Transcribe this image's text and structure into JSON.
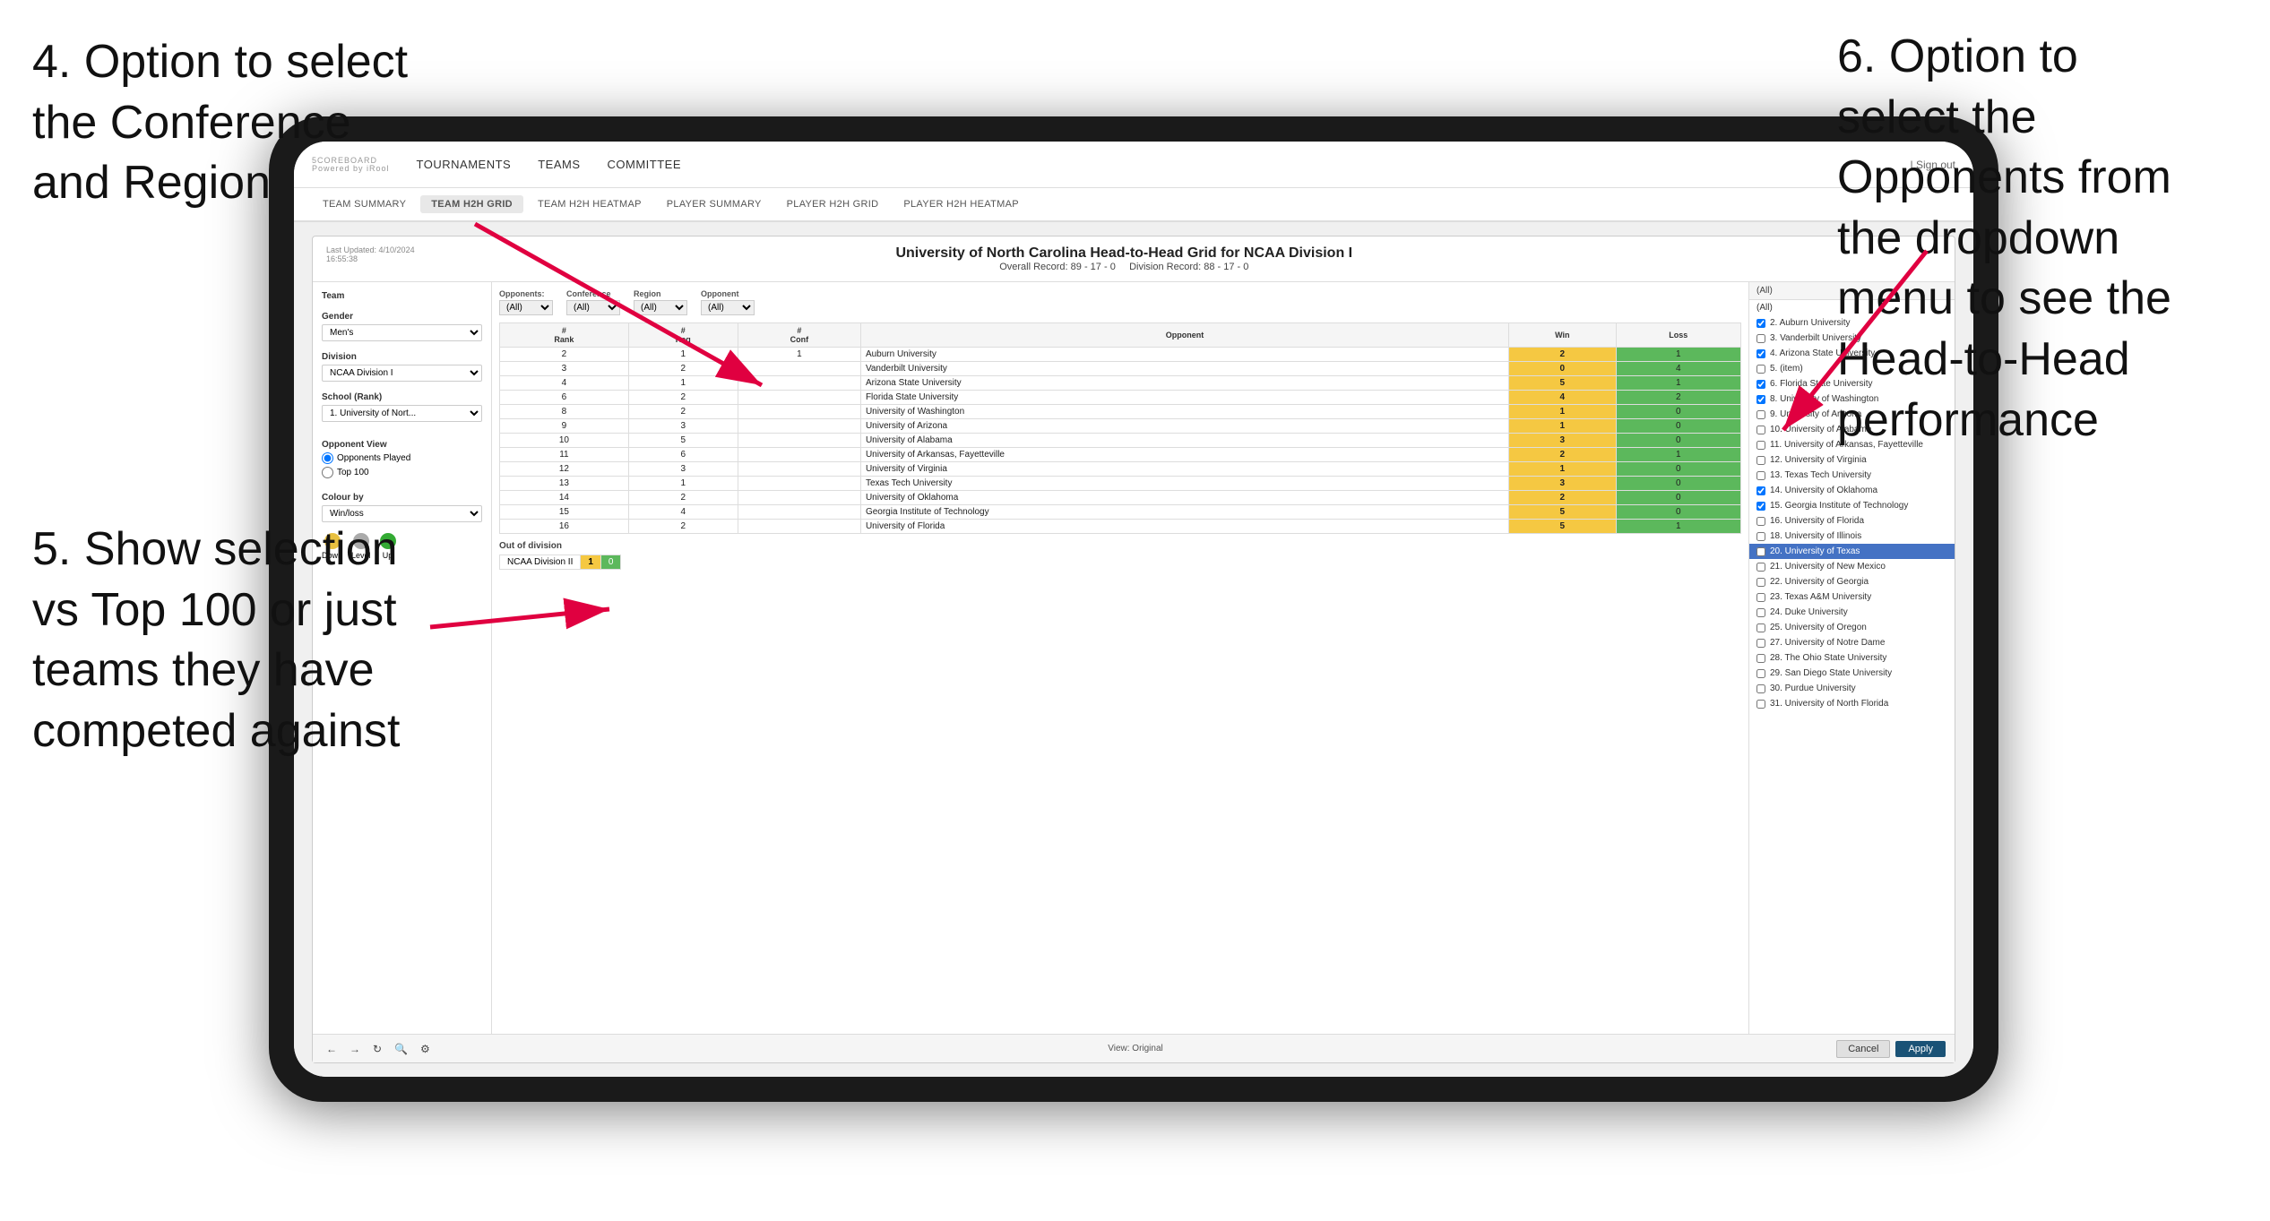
{
  "annotations": {
    "top_left": "4. Option to select\nthe Conference\nand Region",
    "bottom_left": "5. Show selection\nvs Top 100 or just\nteams they have\ncompeted against",
    "top_right": "6. Option to\nselect the\nOpponents from\nthe dropdown\nmenu to see the\nHead-to-Head\nperformance"
  },
  "app": {
    "logo": "5COREBOARD",
    "logo_sub": "Powered by iRool",
    "nav_links": [
      "TOURNAMENTS",
      "TEAMS",
      "COMMITTEE"
    ],
    "nav_right": "| Sign out",
    "sub_nav": [
      "TEAM SUMMARY",
      "TEAM H2H GRID",
      "TEAM H2H HEATMAP",
      "PLAYER SUMMARY",
      "PLAYER H2H GRID",
      "PLAYER H2H HEATMAP"
    ]
  },
  "panel": {
    "last_updated_label": "Last Updated: 4/10/2024",
    "last_updated_time": "16:55:38",
    "title": "University of North Carolina Head-to-Head Grid for NCAA Division I",
    "overall_record_label": "Overall Record:",
    "overall_record": "89 - 17 - 0",
    "division_record_label": "Division Record:",
    "division_record": "88 - 17 - 0"
  },
  "sidebar": {
    "team_label": "Team",
    "gender_label": "Gender",
    "gender_value": "Men's",
    "division_label": "Division",
    "division_value": "NCAA Division I",
    "school_label": "School (Rank)",
    "school_value": "1. University of Nort...",
    "opponent_view_label": "Opponent View",
    "opponents_played": "Opponents Played",
    "top_100": "Top 100",
    "colour_by_label": "Colour by",
    "colour_value": "Win/loss",
    "legend": {
      "down_label": "Down",
      "level_label": "Level",
      "up_label": "Up"
    }
  },
  "filters": {
    "opponents_label": "Opponents:",
    "opponents_value": "(All)",
    "conference_label": "Conference",
    "conference_value": "(All)",
    "region_label": "Region",
    "region_value": "(All)",
    "opponent_label": "Opponent",
    "opponent_value": "(All)"
  },
  "table": {
    "headers": [
      "#\nRank",
      "#\nReg",
      "#\nConf",
      "Opponent",
      "Win",
      "Loss"
    ],
    "rows": [
      {
        "rank": "2",
        "reg": "1",
        "conf": "1",
        "opponent": "Auburn University",
        "win": "2",
        "loss": "1",
        "win_color": "yellow",
        "loss_color": "green"
      },
      {
        "rank": "3",
        "reg": "2",
        "conf": "",
        "opponent": "Vanderbilt University",
        "win": "0",
        "loss": "4",
        "win_color": "yellow",
        "loss_color": "green"
      },
      {
        "rank": "4",
        "reg": "1",
        "conf": "",
        "opponent": "Arizona State University",
        "win": "5",
        "loss": "1",
        "win_color": "yellow",
        "loss_color": "green"
      },
      {
        "rank": "6",
        "reg": "2",
        "conf": "",
        "opponent": "Florida State University",
        "win": "4",
        "loss": "2",
        "win_color": "yellow",
        "loss_color": "green"
      },
      {
        "rank": "8",
        "reg": "2",
        "conf": "",
        "opponent": "University of Washington",
        "win": "1",
        "loss": "0",
        "win_color": "yellow",
        "loss_color": "green"
      },
      {
        "rank": "9",
        "reg": "3",
        "conf": "",
        "opponent": "University of Arizona",
        "win": "1",
        "loss": "0",
        "win_color": "yellow",
        "loss_color": "green"
      },
      {
        "rank": "10",
        "reg": "5",
        "conf": "",
        "opponent": "University of Alabama",
        "win": "3",
        "loss": "0",
        "win_color": "yellow",
        "loss_color": "green"
      },
      {
        "rank": "11",
        "reg": "6",
        "conf": "",
        "opponent": "University of Arkansas, Fayetteville",
        "win": "2",
        "loss": "1",
        "win_color": "yellow",
        "loss_color": "green"
      },
      {
        "rank": "12",
        "reg": "3",
        "conf": "",
        "opponent": "University of Virginia",
        "win": "1",
        "loss": "0",
        "win_color": "yellow",
        "loss_color": "green"
      },
      {
        "rank": "13",
        "reg": "1",
        "conf": "",
        "opponent": "Texas Tech University",
        "win": "3",
        "loss": "0",
        "win_color": "yellow",
        "loss_color": "green"
      },
      {
        "rank": "14",
        "reg": "2",
        "conf": "",
        "opponent": "University of Oklahoma",
        "win": "2",
        "loss": "0",
        "win_color": "yellow",
        "loss_color": "green"
      },
      {
        "rank": "15",
        "reg": "4",
        "conf": "",
        "opponent": "Georgia Institute of Technology",
        "win": "5",
        "loss": "0",
        "win_color": "yellow",
        "loss_color": "green"
      },
      {
        "rank": "16",
        "reg": "2",
        "conf": "",
        "opponent": "University of Florida",
        "win": "5",
        "loss": "1",
        "win_color": "yellow",
        "loss_color": "green"
      }
    ],
    "out_of_division_label": "Out of division",
    "out_of_division_row": {
      "name": "NCAA Division II",
      "win": "1",
      "loss": "0"
    }
  },
  "dropdown": {
    "header": "(All)",
    "items": [
      {
        "label": "(All)",
        "checked": false,
        "selected": false
      },
      {
        "label": "2. Auburn University",
        "checked": true,
        "selected": false
      },
      {
        "label": "3. Vanderbilt University",
        "checked": false,
        "selected": false
      },
      {
        "label": "4. Arizona State University",
        "checked": true,
        "selected": false
      },
      {
        "label": "5. (item)",
        "checked": false,
        "selected": false
      },
      {
        "label": "6. Florida State University",
        "checked": true,
        "selected": false
      },
      {
        "label": "8. University of Washington",
        "checked": true,
        "selected": false
      },
      {
        "label": "9. University of Arizona",
        "checked": false,
        "selected": false
      },
      {
        "label": "10. University of Alabama",
        "checked": false,
        "selected": false
      },
      {
        "label": "11. University of Arkansas, Fayetteville",
        "checked": false,
        "selected": false
      },
      {
        "label": "12. University of Virginia",
        "checked": false,
        "selected": false
      },
      {
        "label": "13. Texas Tech University",
        "checked": false,
        "selected": false
      },
      {
        "label": "14. University of Oklahoma",
        "checked": true,
        "selected": false
      },
      {
        "label": "15. Georgia Institute of Technology",
        "checked": true,
        "selected": false
      },
      {
        "label": "16. University of Florida",
        "checked": false,
        "selected": false
      },
      {
        "label": "18. University of Illinois",
        "checked": false,
        "selected": false
      },
      {
        "label": "20. University of Texas",
        "checked": false,
        "selected": true
      },
      {
        "label": "21. University of New Mexico",
        "checked": false,
        "selected": false
      },
      {
        "label": "22. University of Georgia",
        "checked": false,
        "selected": false
      },
      {
        "label": "23. Texas A&M University",
        "checked": false,
        "selected": false
      },
      {
        "label": "24. Duke University",
        "checked": false,
        "selected": false
      },
      {
        "label": "25. University of Oregon",
        "checked": false,
        "selected": false
      },
      {
        "label": "27. University of Notre Dame",
        "checked": false,
        "selected": false
      },
      {
        "label": "28. The Ohio State University",
        "checked": false,
        "selected": false
      },
      {
        "label": "29. San Diego State University",
        "checked": false,
        "selected": false
      },
      {
        "label": "30. Purdue University",
        "checked": false,
        "selected": false
      },
      {
        "label": "31. University of North Florida",
        "checked": false,
        "selected": false
      }
    ]
  },
  "toolbar": {
    "cancel_label": "Cancel",
    "apply_label": "Apply",
    "view_label": "View: Original"
  }
}
